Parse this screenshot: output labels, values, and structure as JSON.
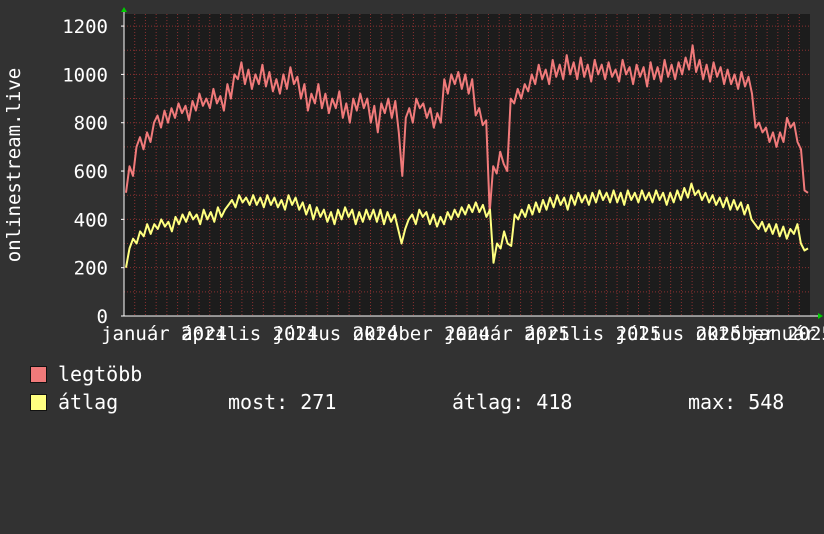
{
  "chart_data": {
    "type": "line",
    "ylabel": "onlinestream.live",
    "ylim": [
      0,
      1250
    ],
    "yticks": [
      0,
      200,
      400,
      600,
      800,
      1000,
      1200
    ],
    "xtick_labels": [
      "január 2024",
      "április 2024",
      "július 2024",
      "október 2024",
      "január 2025",
      "április 2025",
      "július 2025",
      "október 2025"
    ],
    "xtick_overlay_label": "január",
    "colors": {
      "background": "#323232",
      "plot": "#1c1c1c",
      "grid": "#8a3030",
      "axis": "#ffffff",
      "accent": "#00cc00"
    },
    "series": [
      {
        "name": "legtöbb",
        "color": "#f07a7a",
        "values": [
          510,
          620,
          580,
          700,
          740,
          690,
          760,
          720,
          800,
          830,
          780,
          850,
          800,
          860,
          820,
          880,
          840,
          870,
          810,
          890,
          850,
          920,
          870,
          900,
          860,
          940,
          880,
          910,
          850,
          960,
          900,
          1000,
          980,
          1050,
          960,
          1020,
          940,
          1000,
          960,
          1040,
          950,
          1010,
          930,
          980,
          920,
          1000,
          940,
          1030,
          960,
          990,
          900,
          960,
          850,
          920,
          880,
          960,
          860,
          920,
          840,
          900,
          860,
          930,
          820,
          880,
          800,
          900,
          850,
          920,
          860,
          900,
          800,
          870,
          760,
          880,
          840,
          900,
          820,
          890,
          760,
          580,
          820,
          860,
          800,
          900,
          860,
          880,
          820,
          860,
          780,
          840,
          800,
          980,
          920,
          1000,
          960,
          1010,
          940,
          1000,
          920,
          980,
          830,
          860,
          790,
          810,
          430,
          620,
          590,
          680,
          630,
          600,
          900,
          880,
          940,
          900,
          960,
          930,
          1000,
          960,
          1040,
          980,
          1020,
          960,
          1060,
          990,
          1040,
          980,
          1080,
          1000,
          1050,
          980,
          1070,
          990,
          1040,
          970,
          1060,
          1000,
          1040,
          980,
          1050,
          990,
          1020,
          970,
          1060,
          1000,
          1030,
          960,
          1040,
          990,
          1030,
          950,
          1050,
          980,
          1030,
          970,
          1060,
          990,
          1040,
          980,
          1050,
          1000,
          1070,
          1020,
          1120,
          1010,
          1060,
          980,
          1040,
          970,
          1050,
          990,
          1030,
          960,
          1020,
          960,
          1000,
          940,
          1010,
          950,
          990,
          920,
          780,
          800,
          760,
          780,
          720,
          760,
          700,
          760,
          720,
          820,
          780,
          800,
          720,
          690,
          520,
          510
        ]
      },
      {
        "name": "átlag",
        "color": "#ffff80",
        "values": [
          200,
          280,
          320,
          300,
          350,
          330,
          380,
          340,
          380,
          360,
          400,
          370,
          390,
          350,
          410,
          380,
          420,
          390,
          430,
          400,
          420,
          380,
          440,
          400,
          430,
          390,
          450,
          410,
          440,
          460,
          480,
          450,
          500,
          470,
          490,
          460,
          500,
          460,
          490,
          450,
          500,
          460,
          490,
          450,
          480,
          440,
          500,
          460,
          490,
          440,
          470,
          420,
          460,
          400,
          450,
          410,
          440,
          390,
          430,
          380,
          440,
          400,
          450,
          410,
          440,
          380,
          430,
          390,
          440,
          400,
          440,
          390,
          440,
          380,
          430,
          390,
          420,
          360,
          300,
          360,
          400,
          420,
          380,
          440,
          410,
          430,
          380,
          420,
          370,
          410,
          380,
          430,
          400,
          440,
          410,
          450,
          420,
          460,
          430,
          470,
          430,
          460,
          410,
          440,
          220,
          300,
          280,
          350,
          300,
          290,
          420,
          400,
          440,
          410,
          460,
          420,
          470,
          430,
          480,
          440,
          490,
          450,
          500,
          460,
          490,
          440,
          500,
          460,
          510,
          470,
          500,
          460,
          510,
          470,
          520,
          480,
          510,
          470,
          520,
          470,
          510,
          460,
          520,
          480,
          510,
          470,
          520,
          480,
          510,
          470,
          520,
          480,
          510,
          460,
          510,
          470,
          520,
          480,
          530,
          490,
          548,
          500,
          520,
          480,
          510,
          470,
          500,
          460,
          490,
          450,
          490,
          440,
          480,
          440,
          470,
          420,
          460,
          400,
          380,
          360,
          390,
          350,
          380,
          340,
          380,
          330,
          370,
          320,
          360,
          340,
          380,
          300,
          271,
          280
        ]
      }
    ]
  },
  "legend": [
    {
      "label": "legtöbb",
      "color": "#f07a7a"
    },
    {
      "label": "átlag",
      "color": "#ffff80"
    }
  ],
  "stats": {
    "most": "most: 271",
    "atlag": "átlag: 418",
    "max": "max: 548"
  }
}
